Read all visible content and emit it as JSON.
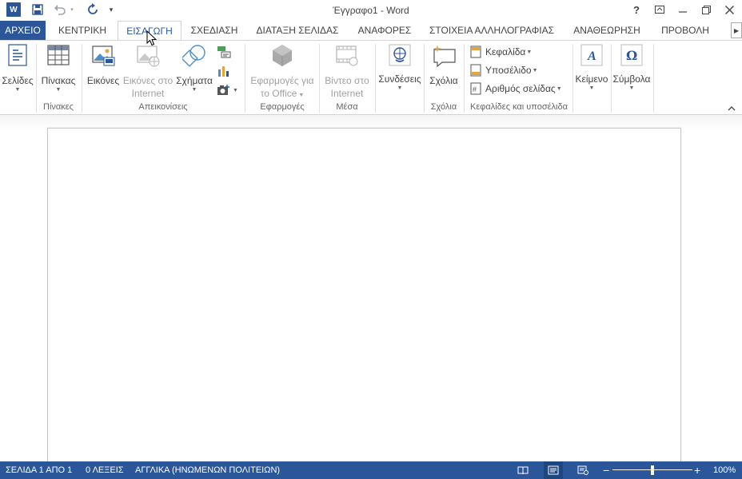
{
  "window": {
    "title": "Έγγραφο1 - Word",
    "help_label": "?",
    "accent_color": "#2b579a"
  },
  "quick_access": {
    "app_logo": "W",
    "icons": [
      "save-icon",
      "undo-icon",
      "repeat-icon",
      "customize-icon"
    ]
  },
  "tabs": [
    {
      "label": "ΑΡΧΕΙΟ"
    },
    {
      "label": "ΚΕΝΤΡΙΚΗ"
    },
    {
      "label": "ΕΙΣΑΓΩΓΗ",
      "active": true
    },
    {
      "label": "ΣΧΕΔΙΑΣΗ"
    },
    {
      "label": "ΔΙΑΤΑΞΗ ΣΕΛΙΔΑΣ"
    },
    {
      "label": "ΑΝΑΦΟΡΕΣ"
    },
    {
      "label": "ΣΤΟΙΧΕΙΑ ΑΛΛΗΛΟΓΡΑΦΙΑΣ"
    },
    {
      "label": "ΑΝΑΘΕΩΡΗΣΗ"
    },
    {
      "label": "ΠΡΟΒΟΛΗ"
    }
  ],
  "ribbon": {
    "pages": {
      "label": "Σελίδες"
    },
    "tables": {
      "label": "Πίνακας",
      "group": "Πίνακες"
    },
    "illustrations": {
      "group": "Απεικονίσεις",
      "pictures": "Εικόνες",
      "online_pictures_1": "Εικόνες στο",
      "online_pictures_2": "Internet",
      "shapes": "Σχήματα"
    },
    "apps": {
      "group": "Εφαρμογές",
      "label_1": "Εφαρμογές για",
      "label_2": "το Office"
    },
    "media": {
      "group": "Μέσα",
      "label_1": "Βίντεο στο",
      "label_2": "Internet"
    },
    "links": {
      "label": "Συνδέσεις"
    },
    "comments": {
      "label": "Σχόλια",
      "group": "Σχόλια"
    },
    "header_footer": {
      "group": "Κεφαλίδες και υποσέλιδα",
      "header": "Κεφαλίδα",
      "footer": "Υποσέλιδο",
      "page_number": "Αριθμός σελίδας"
    },
    "text": {
      "label": "Κείμενο"
    },
    "symbols": {
      "label": "Σύμβολα"
    }
  },
  "statusbar": {
    "page": "ΣΕΛΙΔΑ 1 ΑΠΟ 1",
    "words": "0 ΛΕΞΕΙΣ",
    "language": "ΑΓΓΛΙΚΑ (ΗΝΩΜΕΝΩΝ ΠΟΛΙΤΕΙΩΝ)",
    "zoom_minus": "−",
    "zoom_plus": "+",
    "zoom": "100%",
    "zoom_level": 0.5
  }
}
